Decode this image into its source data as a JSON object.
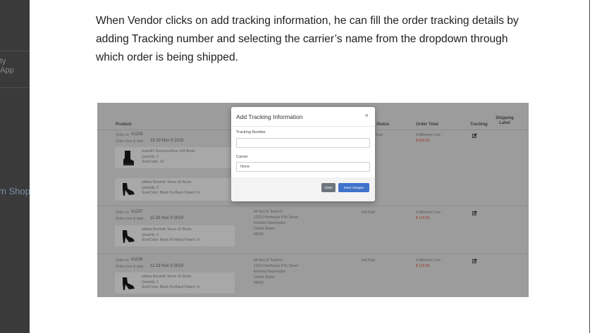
{
  "left_panel": {
    "fragment_1": "ty",
    "fragment_2": "App",
    "fragment_3": "m Shop"
  },
  "description": "When Vendor clicks on add tracking information, he can fill the order tracking details by adding Tracking number and selecting the carrier’s name from the dropdown through which order is being shipped.",
  "table": {
    "headers": {
      "product": "Product",
      "status": "Status",
      "order_total": "Order Total",
      "tracking": "Tracking",
      "shipping_label": "Shipping Label"
    },
    "orders": [
      {
        "order_id_label": "Order id:",
        "order_id": "#1238",
        "order_time_label": "Order time & date:",
        "order_time": "15:19 Nov 9 2019",
        "status": "Paid",
        "total_label": "Fulfillment Cost:",
        "total": "$ 625.93",
        "items": [
          {
            "name": "brand22 Demonia Bear-104 Boots",
            "qty": "Quantity: 2",
            "size": "Size/Color: 10"
          },
          {
            "name": "adidas Bordello Teeze-10 Boots",
            "qty": "Quantity: 2",
            "size": "Size/Color: Black Pu-Black Patent / 6"
          }
        ]
      },
      {
        "order_id_label": "Order id:",
        "order_id": "#1237",
        "order_time_label": "Order time & date:",
        "order_time": "11:26 Nov 9 2019",
        "address": [
          "84 Nov19 Test2=4",
          "12323 Northeast 97th Street",
          "Kirkland,Washington",
          "United States",
          "98033"
        ],
        "status": "Not Paid",
        "total_label": "Fulfillment Cost:",
        "total": "$ 149.86",
        "items": [
          {
            "name": "adidas Bordello Teeze-10 Boots",
            "qty": "Quantity: 1",
            "size": "Size/Color: Black Pu-Black Patent / 6"
          }
        ]
      },
      {
        "order_id_label": "Order id:",
        "order_id": "#1236",
        "order_time_label": "Order time & date:",
        "order_time": "11:19 Nov 9 2019",
        "address": [
          "84 Nov19 Test2=4",
          "12323 Northeast 97th Street",
          "Kirkland,Washington",
          "United States",
          "98033"
        ],
        "status": "Not Paid",
        "total_label": "Fulfillment Cost:",
        "total": "$ 149.86",
        "items": [
          {
            "name": "adidas Bordello Teeze-10 Boots",
            "qty": "Quantity: 1",
            "size": "Size/Color: Black Pu-Black Patent / 6"
          }
        ]
      }
    ]
  },
  "modal": {
    "title": "Add Tracking Information",
    "close_glyph": "×",
    "tracking_label": "Tracking Number",
    "tracking_value": "",
    "carrier_label": "Carrier",
    "carrier_value": "None",
    "close_button": "Close",
    "save_button": "Save changes"
  },
  "icons": {
    "edit": "edit-icon",
    "shoe": "shoe-image"
  },
  "colors": {
    "save_button": "#3f72c9",
    "close_button": "#6c757d",
    "cost_text": "#9b3a2a"
  }
}
